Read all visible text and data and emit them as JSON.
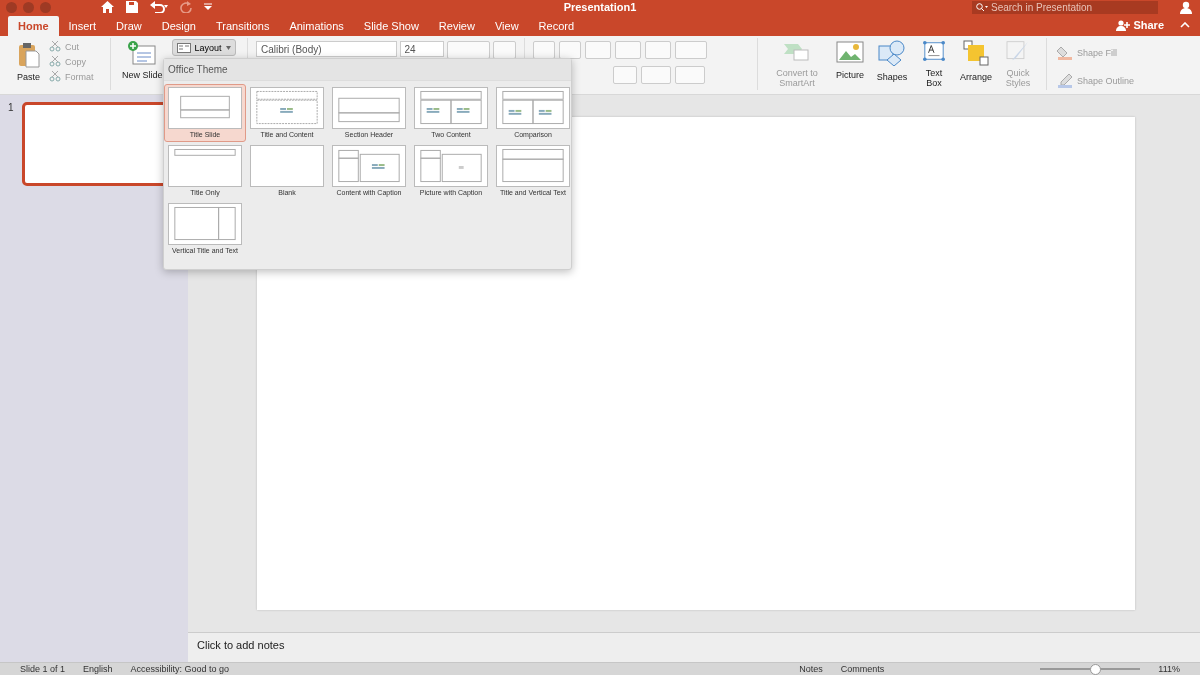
{
  "window": {
    "title": "Presentation1",
    "search_placeholder": "Search in Presentation"
  },
  "tabs": [
    {
      "label": "Home",
      "selected": true
    },
    {
      "label": "Insert",
      "selected": false
    },
    {
      "label": "Draw",
      "selected": false
    },
    {
      "label": "Design",
      "selected": false
    },
    {
      "label": "Transitions",
      "selected": false
    },
    {
      "label": "Animations",
      "selected": false
    },
    {
      "label": "Slide Show",
      "selected": false
    },
    {
      "label": "Review",
      "selected": false
    },
    {
      "label": "View",
      "selected": false
    },
    {
      "label": "Record",
      "selected": false
    }
  ],
  "share": "Share",
  "ribbon": {
    "paste": "Paste",
    "clipboard": [
      {
        "label": "Cut",
        "disabled": true
      },
      {
        "label": "Copy",
        "disabled": true
      },
      {
        "label": "Format",
        "disabled": true
      }
    ],
    "new_slide": "New Slide",
    "layout": "Layout",
    "font": "Calibri (Body)",
    "font_size": "24",
    "tools": [
      {
        "label": "Convert to SmartArt",
        "kind": "smartart",
        "disabled": true
      },
      {
        "label": "Picture",
        "kind": "picture",
        "disabled": false
      },
      {
        "label": "Shapes",
        "kind": "shapes",
        "disabled": false
      },
      {
        "label": "Text Box",
        "kind": "textbox",
        "disabled": false
      },
      {
        "label": "Arrange",
        "kind": "arrange",
        "disabled": false
      },
      {
        "label": "Quick Styles",
        "kind": "styles",
        "disabled": true
      }
    ],
    "shape_format": [
      {
        "label": "Shape Fill",
        "kind": "fill",
        "disabled": true
      },
      {
        "label": "Shape Outline",
        "kind": "outline",
        "disabled": true
      }
    ]
  },
  "layout_menu": {
    "heading": "Office Theme",
    "layouts": [
      {
        "label": "Title Slide",
        "kind": "title",
        "selected": true
      },
      {
        "label": "Title and Content",
        "kind": "title-content",
        "selected": false
      },
      {
        "label": "Section Header",
        "kind": "section",
        "selected": false
      },
      {
        "label": "Two Content",
        "kind": "two-content",
        "selected": false
      },
      {
        "label": "Comparison",
        "kind": "comparison",
        "selected": false
      },
      {
        "label": "Title Only",
        "kind": "title-only",
        "selected": false
      },
      {
        "label": "Blank",
        "kind": "blank",
        "selected": false
      },
      {
        "label": "Content with Caption",
        "kind": "content-caption",
        "selected": false
      },
      {
        "label": "Picture with Caption",
        "kind": "picture-caption",
        "selected": false
      },
      {
        "label": "Title and Vertical Text",
        "kind": "vertical-text",
        "selected": false
      },
      {
        "label": "Vertical Title and Text",
        "kind": "vertical-title",
        "selected": false
      }
    ]
  },
  "slides": [
    {
      "number": "1",
      "selected": true
    }
  ],
  "notes_placeholder": "Click to add notes",
  "status_bar": {
    "items": [
      "Slide 1 of 1",
      "English",
      "Accessibility: Good to go"
    ],
    "notes": "Notes",
    "comments": "Comments",
    "zoom": "111%",
    "zoom_level": {
      "level": 0.55
    }
  }
}
